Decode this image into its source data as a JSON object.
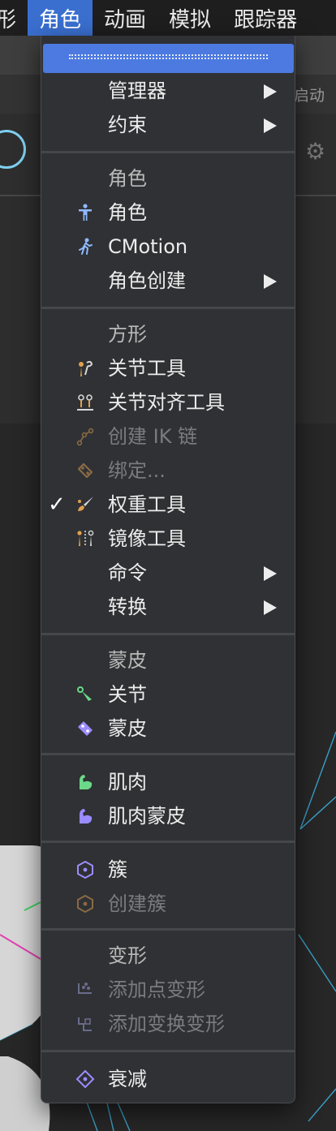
{
  "menubar": {
    "items": [
      "形",
      "角色",
      "动画",
      "模拟",
      "跟踪器"
    ],
    "active_index": 1
  },
  "background": {
    "auto_start_label": "启动"
  },
  "menu": {
    "items": [
      {
        "label": "管理器",
        "submenu": true
      },
      {
        "label": "约束",
        "submenu": true
      },
      {
        "label": "角色",
        "header": true
      },
      {
        "label": "角色",
        "icon": "character-icon"
      },
      {
        "label": "CMotion",
        "icon": "cmotion-icon"
      },
      {
        "label": "角色创建",
        "submenu": true
      },
      {
        "label": "方形",
        "header": true
      },
      {
        "label": "关节工具",
        "icon": "joint-tool-icon"
      },
      {
        "label": "关节对齐工具",
        "icon": "joint-align-icon"
      },
      {
        "label": "创建 IK 链",
        "icon": "ik-chain-icon",
        "disabled": true
      },
      {
        "label": "绑定...",
        "icon": "bind-icon",
        "disabled": true
      },
      {
        "label": "权重工具",
        "icon": "weight-brush-icon",
        "checked": true
      },
      {
        "label": "镜像工具",
        "icon": "mirror-tool-icon"
      },
      {
        "label": "命令",
        "submenu": true
      },
      {
        "label": "转换",
        "submenu": true
      },
      {
        "label": "蒙皮",
        "header": true
      },
      {
        "label": "关节",
        "icon": "joint-icon"
      },
      {
        "label": "蒙皮",
        "icon": "skin-icon"
      },
      {
        "label": "肌肉",
        "icon": "muscle-icon"
      },
      {
        "label": "肌肉蒙皮",
        "icon": "muscle-skin-icon"
      },
      {
        "label": "簇",
        "icon": "cluster-icon"
      },
      {
        "label": "创建簇",
        "icon": "create-cluster-icon",
        "disabled": true
      },
      {
        "label": "变形",
        "header": true
      },
      {
        "label": "添加点变形",
        "icon": "point-deform-icon",
        "disabled": true
      },
      {
        "label": "添加变换变形",
        "icon": "transform-deform-icon",
        "disabled": true
      },
      {
        "label": "衰减",
        "icon": "falloff-icon"
      }
    ],
    "check_glyph": "✓"
  },
  "colors": {
    "menubar_active": "#3a6fd0",
    "tearoff": "#4c7ae0",
    "menu_bg": "#2f3134",
    "icon_blue": "#8fb8ff",
    "icon_orange": "#e0a050",
    "icon_green": "#6cd88a",
    "icon_purple": "#9a8cff"
  }
}
